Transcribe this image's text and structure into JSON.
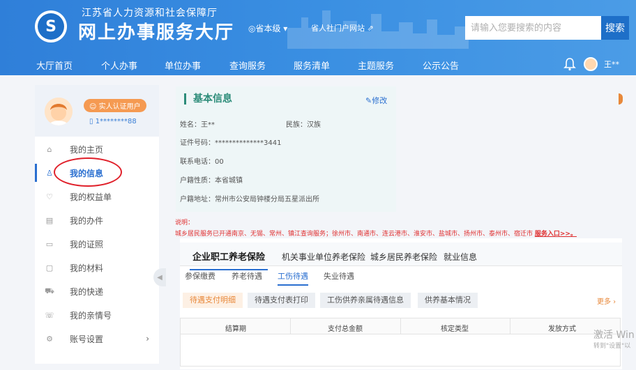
{
  "header": {
    "org_title": "江苏省人力资源和社会保障厅",
    "hall_title": "网上办事服务大厅",
    "province_selector": "◎省本级 ▾",
    "portal_link": "省人社门户网站 ⇗",
    "search": {
      "placeholder": "请输入您要搜索的内容",
      "button": "搜索"
    },
    "nav": [
      "大厅首页",
      "个人办事",
      "单位办事",
      "查询服务",
      "服务清单",
      "主题服务",
      "公示公告"
    ],
    "user_name": "王**"
  },
  "sidebar": {
    "badge": "☺ 实人认证用户",
    "phone": "1********88",
    "items": [
      {
        "label": "我的主页",
        "icon": "home-icon"
      },
      {
        "label": "我的信息",
        "icon": "user-icon"
      },
      {
        "label": "我的权益单",
        "icon": "heart-icon"
      },
      {
        "label": "我的办件",
        "icon": "document-icon"
      },
      {
        "label": "我的证照",
        "icon": "id-card-icon"
      },
      {
        "label": "我的材料",
        "icon": "folder-icon"
      },
      {
        "label": "我的快递",
        "icon": "truck-icon"
      },
      {
        "label": "我的亲情号",
        "icon": "family-icon"
      },
      {
        "label": "账号设置",
        "icon": "gear-icon"
      }
    ],
    "active_index": 1
  },
  "basic_info": {
    "title": "基本信息",
    "edit": "修改",
    "name": "姓名：王**",
    "ethnicity": "民族：汉族",
    "id_number": "证件号码：**************3441",
    "phone": "联系电话：00",
    "hukou_type": "户籍性质：本省城镇",
    "hukou_address": "户籍地址：常州市公安局钟楼分局五星派出所"
  },
  "notice": {
    "label": "说明：",
    "text": "城乡居民服务已开通南京、无锡、常州、镇江查询服务；徐州市、南通市、连云港市、淮安市、盐城市、扬州市、泰州市、宿迁市",
    "link": "服务入口>>。"
  },
  "pension": {
    "tabs": [
      "企业职工养老保险",
      "机关事业单位养老保险",
      "城乡居民养老保险",
      "就业信息"
    ],
    "subtabs": [
      "参保缴费",
      "养老待遇",
      "工伤待遇",
      "失业待遇"
    ],
    "pills": [
      "待遇支付明细",
      "待遇支付表打印",
      "工伤供养亲属待遇信息",
      "供养基本情况"
    ],
    "more": "更多 ›",
    "columns": [
      "结算期",
      "支付总金额",
      "核定类型",
      "发放方式"
    ]
  },
  "watermark": {
    "line1": "激活 Win",
    "line2": "转到\"设置\"以"
  },
  "colors": {
    "header_blue": "#2f7fd9",
    "accent_blue": "#2a6fd0",
    "teal": "#2c8c79",
    "orange": "#e8883a",
    "red": "#e03030"
  }
}
